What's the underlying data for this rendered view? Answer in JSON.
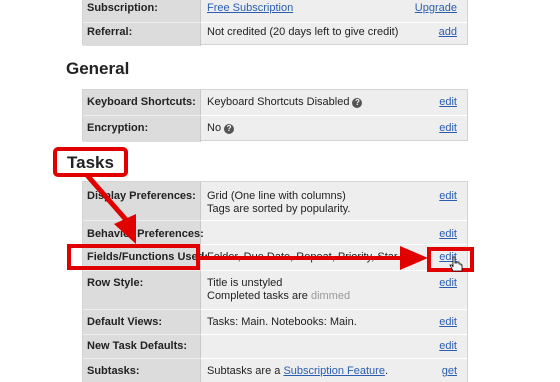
{
  "account_rows": [
    {
      "label": "Subscription:",
      "value": "Free Subscription",
      "action": "Upgrade"
    },
    {
      "label": "Referral:",
      "value": "Not credited (20 days left to give credit)",
      "action": "add"
    }
  ],
  "general": {
    "title": "General",
    "rows": [
      {
        "label": "Keyboard Shortcuts:",
        "value": "Keyboard Shortcuts Disabled",
        "action": "edit",
        "help_icon": "question-icon"
      },
      {
        "label": "Encryption:",
        "value": "No",
        "action": "edit",
        "help_icon": "question-icon"
      }
    ]
  },
  "tasks": {
    "title": "Tasks",
    "display_preferences": {
      "label": "Display Preferences:",
      "line1": "Grid (One line with columns)",
      "line2": "Tags are sorted by popularity.",
      "action": "edit"
    },
    "behavior_preferences": {
      "label": "Behavior Preferences:",
      "action": "edit"
    },
    "fields_functions": {
      "label": "Fields/Functions Used:",
      "value": "Folder, Due Date, Repeat, Priority, Star",
      "action": "edit"
    },
    "row_style": {
      "label": "Row Style:",
      "line1": "Title is unstyled",
      "line2_prefix": "Completed tasks are",
      "line2_dimmed": "dimmed",
      "action": "edit"
    },
    "default_views": {
      "label": "Default Views:",
      "value": "Tasks: Main. Notebooks: Main.",
      "action": "edit"
    },
    "new_task_defaults": {
      "label": "New Task Defaults:",
      "action": "edit"
    },
    "subtasks": {
      "label": "Subtasks:",
      "value_prefix": "Subtasks are a",
      "value_link": "Subscription Feature",
      "value_suffix": ".",
      "action": "get"
    }
  },
  "annotation_color": "#e00000",
  "link_color": "#2a5db0"
}
